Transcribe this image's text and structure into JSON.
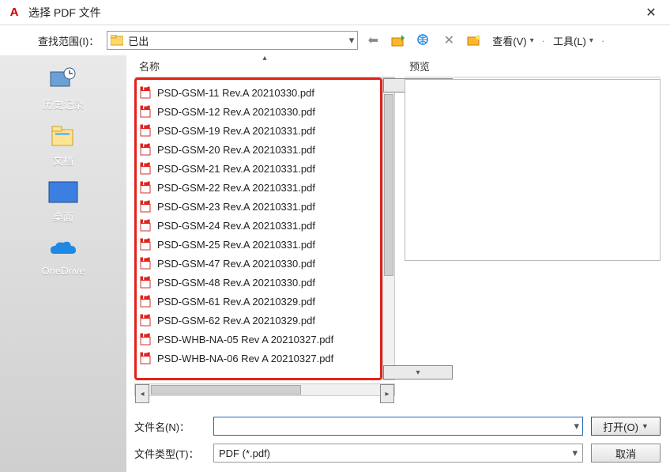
{
  "title": "选择 PDF 文件",
  "toolbar": {
    "look_in_label": "查找范围(I)：",
    "look_in_value": "已出",
    "view_label": "查看(V)",
    "tools_label": "工具(L)"
  },
  "sidebar": {
    "items": [
      {
        "label": "历史记录"
      },
      {
        "label": "文档"
      },
      {
        "label": "桌面"
      },
      {
        "label": "OneDrive"
      }
    ]
  },
  "columns": {
    "name": "名称",
    "preview": "预览"
  },
  "files": [
    "PSD-GSM-11 Rev.A 20210330.pdf",
    "PSD-GSM-12 Rev.A 20210330.pdf",
    "PSD-GSM-19 Rev.A 20210331.pdf",
    "PSD-GSM-20 Rev.A 20210331.pdf",
    "PSD-GSM-21 Rev.A 20210331.pdf",
    "PSD-GSM-22 Rev.A 20210331.pdf",
    "PSD-GSM-23 Rev.A 20210331.pdf",
    "PSD-GSM-24 Rev.A 20210331.pdf",
    "PSD-GSM-25 Rev.A 20210331.pdf",
    "PSD-GSM-47 Rev.A 20210330.pdf",
    "PSD-GSM-48 Rev.A 20210330.pdf",
    "PSD-GSM-61 Rev.A 20210329.pdf",
    "PSD-GSM-62 Rev.A 20210329.pdf",
    "PSD-WHB-NA-05 Rev A 20210327.pdf",
    "PSD-WHB-NA-06 Rev A 20210327.pdf"
  ],
  "filename": {
    "label": "文件名(N)：",
    "value": ""
  },
  "filetype": {
    "label": "文件类型(T)：",
    "value": "PDF (*.pdf)"
  },
  "buttons": {
    "open": "打开(O)",
    "cancel": "取消"
  }
}
